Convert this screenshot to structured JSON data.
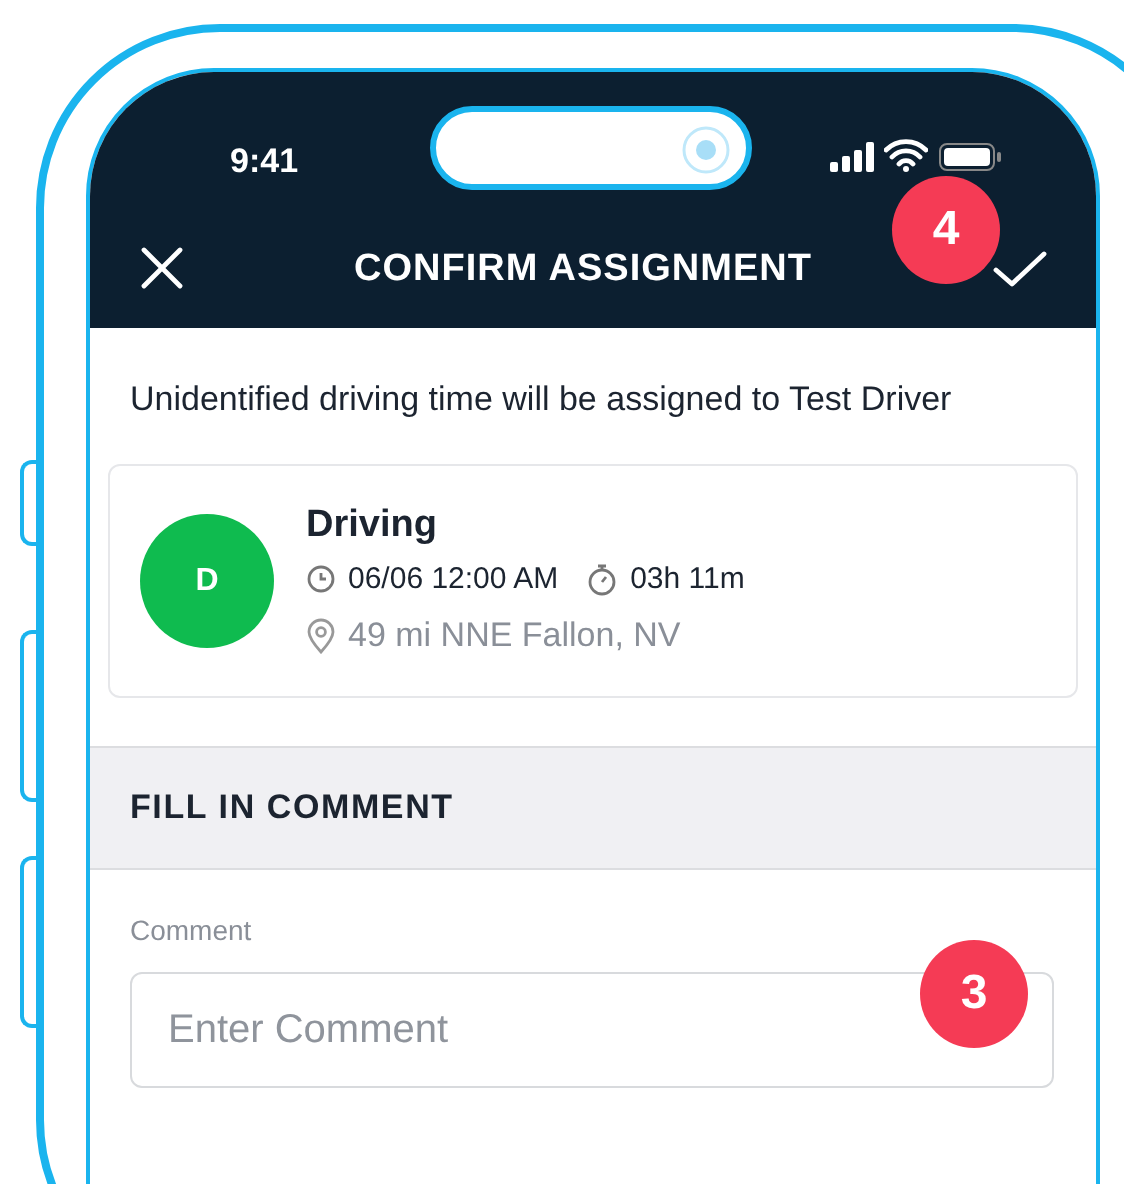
{
  "status_bar": {
    "time": "9:41"
  },
  "nav": {
    "title": "CONFIRM ASSIGNMENT"
  },
  "callouts": [
    {
      "label": "4"
    },
    {
      "label": "3"
    }
  ],
  "message": "Unidentified driving time will be assigned to Test Driver",
  "event": {
    "avatar": "D",
    "color": "#0fbb4f",
    "status": "Driving",
    "start": "06/06 12:00 AM",
    "duration": "03h 11m",
    "location": "49 mi NNE Fallon, NV"
  },
  "section": {
    "title": "FILL IN COMMENT"
  },
  "comment": {
    "label": "Comment",
    "placeholder": "Enter Comment"
  }
}
